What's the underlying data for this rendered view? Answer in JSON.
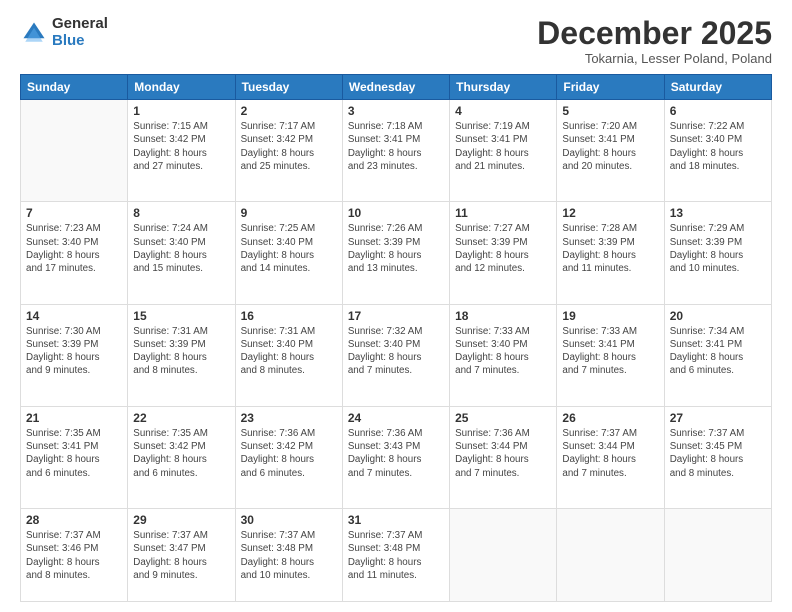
{
  "header": {
    "logo_general": "General",
    "logo_blue": "Blue",
    "month_title": "December 2025",
    "location": "Tokarnia, Lesser Poland, Poland"
  },
  "days_of_week": [
    "Sunday",
    "Monday",
    "Tuesday",
    "Wednesday",
    "Thursday",
    "Friday",
    "Saturday"
  ],
  "weeks": [
    [
      {
        "day": "",
        "text": ""
      },
      {
        "day": "1",
        "text": "Sunrise: 7:15 AM\nSunset: 3:42 PM\nDaylight: 8 hours\nand 27 minutes."
      },
      {
        "day": "2",
        "text": "Sunrise: 7:17 AM\nSunset: 3:42 PM\nDaylight: 8 hours\nand 25 minutes."
      },
      {
        "day": "3",
        "text": "Sunrise: 7:18 AM\nSunset: 3:41 PM\nDaylight: 8 hours\nand 23 minutes."
      },
      {
        "day": "4",
        "text": "Sunrise: 7:19 AM\nSunset: 3:41 PM\nDaylight: 8 hours\nand 21 minutes."
      },
      {
        "day": "5",
        "text": "Sunrise: 7:20 AM\nSunset: 3:41 PM\nDaylight: 8 hours\nand 20 minutes."
      },
      {
        "day": "6",
        "text": "Sunrise: 7:22 AM\nSunset: 3:40 PM\nDaylight: 8 hours\nand 18 minutes."
      }
    ],
    [
      {
        "day": "7",
        "text": "Sunrise: 7:23 AM\nSunset: 3:40 PM\nDaylight: 8 hours\nand 17 minutes."
      },
      {
        "day": "8",
        "text": "Sunrise: 7:24 AM\nSunset: 3:40 PM\nDaylight: 8 hours\nand 15 minutes."
      },
      {
        "day": "9",
        "text": "Sunrise: 7:25 AM\nSunset: 3:40 PM\nDaylight: 8 hours\nand 14 minutes."
      },
      {
        "day": "10",
        "text": "Sunrise: 7:26 AM\nSunset: 3:39 PM\nDaylight: 8 hours\nand 13 minutes."
      },
      {
        "day": "11",
        "text": "Sunrise: 7:27 AM\nSunset: 3:39 PM\nDaylight: 8 hours\nand 12 minutes."
      },
      {
        "day": "12",
        "text": "Sunrise: 7:28 AM\nSunset: 3:39 PM\nDaylight: 8 hours\nand 11 minutes."
      },
      {
        "day": "13",
        "text": "Sunrise: 7:29 AM\nSunset: 3:39 PM\nDaylight: 8 hours\nand 10 minutes."
      }
    ],
    [
      {
        "day": "14",
        "text": "Sunrise: 7:30 AM\nSunset: 3:39 PM\nDaylight: 8 hours\nand 9 minutes."
      },
      {
        "day": "15",
        "text": "Sunrise: 7:31 AM\nSunset: 3:39 PM\nDaylight: 8 hours\nand 8 minutes."
      },
      {
        "day": "16",
        "text": "Sunrise: 7:31 AM\nSunset: 3:40 PM\nDaylight: 8 hours\nand 8 minutes."
      },
      {
        "day": "17",
        "text": "Sunrise: 7:32 AM\nSunset: 3:40 PM\nDaylight: 8 hours\nand 7 minutes."
      },
      {
        "day": "18",
        "text": "Sunrise: 7:33 AM\nSunset: 3:40 PM\nDaylight: 8 hours\nand 7 minutes."
      },
      {
        "day": "19",
        "text": "Sunrise: 7:33 AM\nSunset: 3:41 PM\nDaylight: 8 hours\nand 7 minutes."
      },
      {
        "day": "20",
        "text": "Sunrise: 7:34 AM\nSunset: 3:41 PM\nDaylight: 8 hours\nand 6 minutes."
      }
    ],
    [
      {
        "day": "21",
        "text": "Sunrise: 7:35 AM\nSunset: 3:41 PM\nDaylight: 8 hours\nand 6 minutes."
      },
      {
        "day": "22",
        "text": "Sunrise: 7:35 AM\nSunset: 3:42 PM\nDaylight: 8 hours\nand 6 minutes."
      },
      {
        "day": "23",
        "text": "Sunrise: 7:36 AM\nSunset: 3:42 PM\nDaylight: 8 hours\nand 6 minutes."
      },
      {
        "day": "24",
        "text": "Sunrise: 7:36 AM\nSunset: 3:43 PM\nDaylight: 8 hours\nand 7 minutes."
      },
      {
        "day": "25",
        "text": "Sunrise: 7:36 AM\nSunset: 3:44 PM\nDaylight: 8 hours\nand 7 minutes."
      },
      {
        "day": "26",
        "text": "Sunrise: 7:37 AM\nSunset: 3:44 PM\nDaylight: 8 hours\nand 7 minutes."
      },
      {
        "day": "27",
        "text": "Sunrise: 7:37 AM\nSunset: 3:45 PM\nDaylight: 8 hours\nand 8 minutes."
      }
    ],
    [
      {
        "day": "28",
        "text": "Sunrise: 7:37 AM\nSunset: 3:46 PM\nDaylight: 8 hours\nand 8 minutes."
      },
      {
        "day": "29",
        "text": "Sunrise: 7:37 AM\nSunset: 3:47 PM\nDaylight: 8 hours\nand 9 minutes."
      },
      {
        "day": "30",
        "text": "Sunrise: 7:37 AM\nSunset: 3:48 PM\nDaylight: 8 hours\nand 10 minutes."
      },
      {
        "day": "31",
        "text": "Sunrise: 7:37 AM\nSunset: 3:48 PM\nDaylight: 8 hours\nand 11 minutes."
      },
      {
        "day": "",
        "text": ""
      },
      {
        "day": "",
        "text": ""
      },
      {
        "day": "",
        "text": ""
      }
    ]
  ]
}
